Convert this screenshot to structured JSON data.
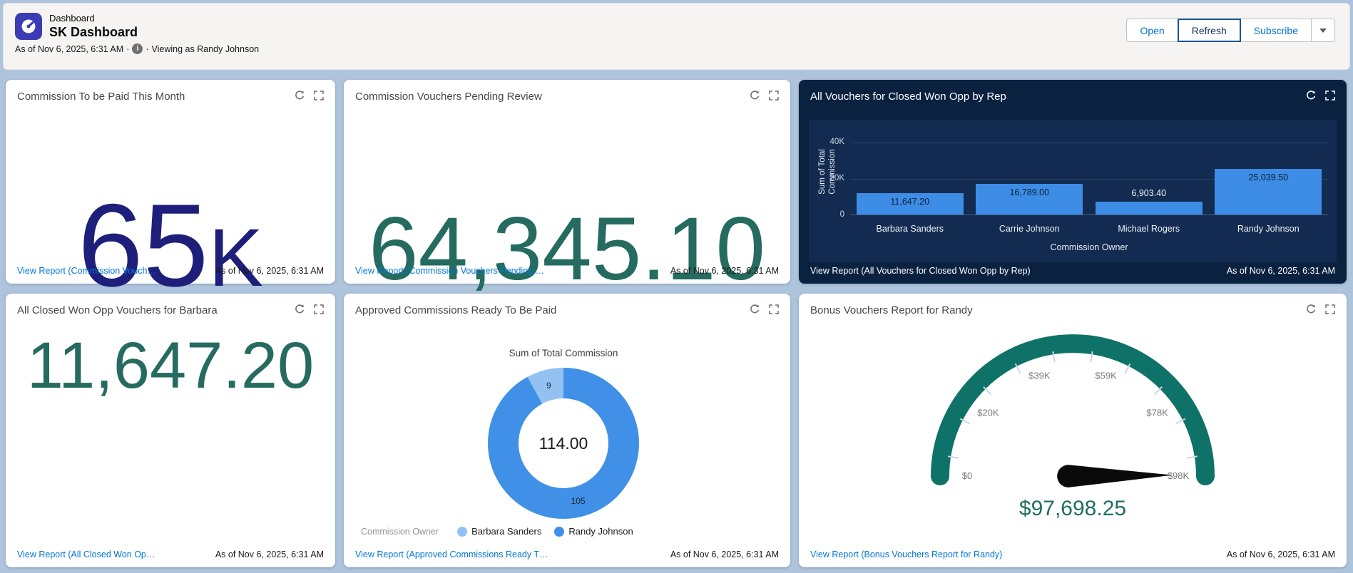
{
  "page": {
    "background": "#aec3dc"
  },
  "header": {
    "object_label": "Dashboard",
    "title": "SK Dashboard",
    "as_of": "As of Nov 6, 2025, 6:31 AM",
    "separator": "·",
    "viewing_as": "Viewing as Randy Johnson",
    "info_icon": "i",
    "buttons": {
      "open": "Open",
      "refresh": "Refresh",
      "subscribe": "Subscribe"
    }
  },
  "cards": [
    {
      "title": "Commission To be Paid This Month",
      "metric": "65",
      "metric_suffix": "K",
      "metric_color": "#1d1f7b",
      "link": "View Report (Commission Vouch…",
      "as_of": "As of Nov 6, 2025, 6:31 AM"
    },
    {
      "title": "Commission Vouchers Pending Review",
      "metric": "64,345.10",
      "metric_color": "#256b60",
      "link": "View Report (Commission Vouchers Pending …",
      "as_of": "As of Nov 6, 2025, 6:31 AM"
    },
    {
      "title": "All Vouchers for Closed Won Opp by Rep",
      "link": "View Report (All Vouchers for Closed Won Opp by Rep)",
      "as_of": "As of Nov 6, 2025, 6:31 AM"
    },
    {
      "title": "All Closed Won Opp Vouchers for Barbara",
      "metric": "11,647.20",
      "metric_color": "#256b60",
      "link": "View Report (All Closed Won Op…",
      "as_of": "As of Nov 6, 2025, 6:31 AM"
    },
    {
      "title": "Approved Commissions Ready To Be Paid",
      "link": "View Report (Approved Commissions Ready T…",
      "as_of": "As of Nov 6, 2025, 6:31 AM"
    },
    {
      "title": "Bonus Vouchers Report for Randy",
      "link": "View Report (Bonus Vouchers Report for Randy)",
      "as_of": "As of Nov 6, 2025, 6:31 AM"
    }
  ],
  "chart_data": [
    {
      "type": "bar",
      "card": "All Vouchers for Closed Won Opp by Rep",
      "categories": [
        "Barbara Sanders",
        "Carrie Johnson",
        "Michael Rogers",
        "Randy Johnson"
      ],
      "values": [
        11647.2,
        16789.0,
        6903.4,
        25039.5
      ],
      "value_labels": [
        "11,647.20",
        "16,789.00",
        "6,903.40",
        "25,039.50"
      ],
      "xlabel": "Commission Owner",
      "ylabel": "Sum of Total Commission",
      "yticks": [
        {
          "value": 0,
          "label": "0"
        },
        {
          "value": 20000,
          "label": "20K"
        },
        {
          "value": 40000,
          "label": "40K"
        }
      ],
      "ylim": [
        0,
        49500
      ],
      "bar_color": "#3d8de6",
      "theme": "dark",
      "grid": true,
      "legend_position": "none"
    },
    {
      "type": "pie",
      "card": "Approved Commissions Ready To Be Paid",
      "title": "Sum of Total Commission",
      "center_label": "114.00",
      "legend_title": "Commission Owner",
      "slices": [
        {
          "name": "Randy Johnson",
          "value": 105,
          "label": "105",
          "color": "#3f90e6"
        },
        {
          "name": "Barbara Sanders",
          "value": 9,
          "label": "9",
          "color": "#93c2f2"
        }
      ],
      "legend": [
        {
          "name": "Barbara Sanders",
          "color": "#93c2f2"
        },
        {
          "name": "Randy Johnson",
          "color": "#3f90e6"
        }
      ],
      "donut": true,
      "legend_position": "bottom"
    },
    {
      "type": "gauge",
      "card": "Bonus Vouchers Report for Randy",
      "value": 97698.25,
      "value_label": "$97,698.25",
      "min": 0,
      "max": 98000,
      "ticks": [
        {
          "value": 0,
          "label": "$0"
        },
        {
          "value": 20000,
          "label": "$20K"
        },
        {
          "value": 39000,
          "label": "$39K"
        },
        {
          "value": 59000,
          "label": "$59K"
        },
        {
          "value": 78000,
          "label": "$78K"
        },
        {
          "value": 98000,
          "label": "$98K"
        }
      ],
      "arc_color": "#0f7268",
      "value_color": "#1f6e62",
      "needle_color": "#0a0a0a",
      "tick_label_color": "#7a7a7a"
    }
  ]
}
